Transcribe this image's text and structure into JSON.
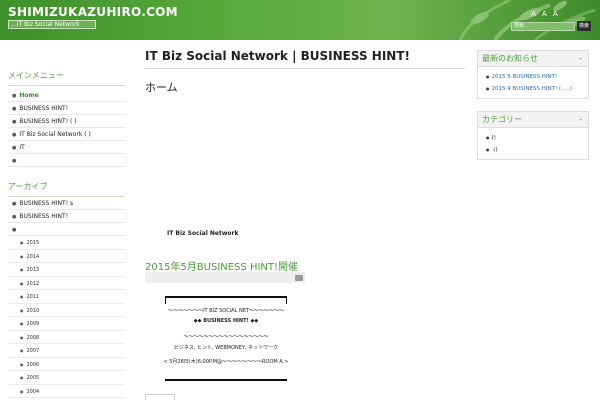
{
  "header": {
    "site_title": "SHIMIZUKAZUHIRO.COM",
    "tagline": "...IT Biz Social Network",
    "font_size_label": "A A A",
    "search_placeholder": "検索...",
    "search_button": "検索"
  },
  "left_sidebar": {
    "section1_heading": "メインメニュー",
    "section1_items": [
      {
        "label": "Home",
        "active": true
      },
      {
        "label": "BUSINESS HINT!",
        "active": false
      },
      {
        "label": "BUSINESS HINT!  (    )",
        "active": false
      },
      {
        "label": "IT Biz Social Network    (    )",
        "active": false
      },
      {
        "label": "IT",
        "active": false
      },
      {
        "label": "",
        "active": false
      }
    ],
    "section2_heading": "アーカイブ",
    "section2_items": [
      "BUSINESS HINT!        s",
      "BUSINESS HINT!",
      ""
    ],
    "years": [
      "2015",
      "2014",
      "2013",
      "2012",
      "2011",
      "2010",
      "2009",
      "2008",
      "2007",
      "2006",
      "2005",
      "2004"
    ]
  },
  "main": {
    "post_title": "IT Biz Social Network | BUSINESS HINT!",
    "post_subtitle": "ホーム",
    "embed_label": "IT Biz Social Network",
    "entry_title": "2015年5月BUSINESS HINT!開催",
    "notice_lines": [
      "〜〜〜〜〜〜〜IT BIZ SOCIAL NET〜〜〜〜〜〜〜",
      "◆◆ BUSINESS HINT! ◆◆",
      "〜〜〜〜〜〜〜〜〜〜〜〜〜〜〜〜〜",
      "ビジネス, ヒント, WEBMONEY, ネットワーク",
      "< 5月28日(木)6:00P.M@〜〜〜〜〜〜〜〜ROOM A >"
    ]
  },
  "right_sidebar": {
    "box1_heading": "最新のお知らせ",
    "box1_toggle": "-",
    "box1_items": [
      "2015 5 BUSINESS HINT!",
      "2015 4 BUSINESS HINT!  (      ....)"
    ],
    "box2_heading": "カテゴリー",
    "box2_toggle": "-",
    "box2_items": [
      "()",
      "      ()"
    ]
  },
  "colors": {
    "header_green": "#56a83b",
    "accent_green": "#4f9f38",
    "link_blue": "#2b6fb3"
  }
}
